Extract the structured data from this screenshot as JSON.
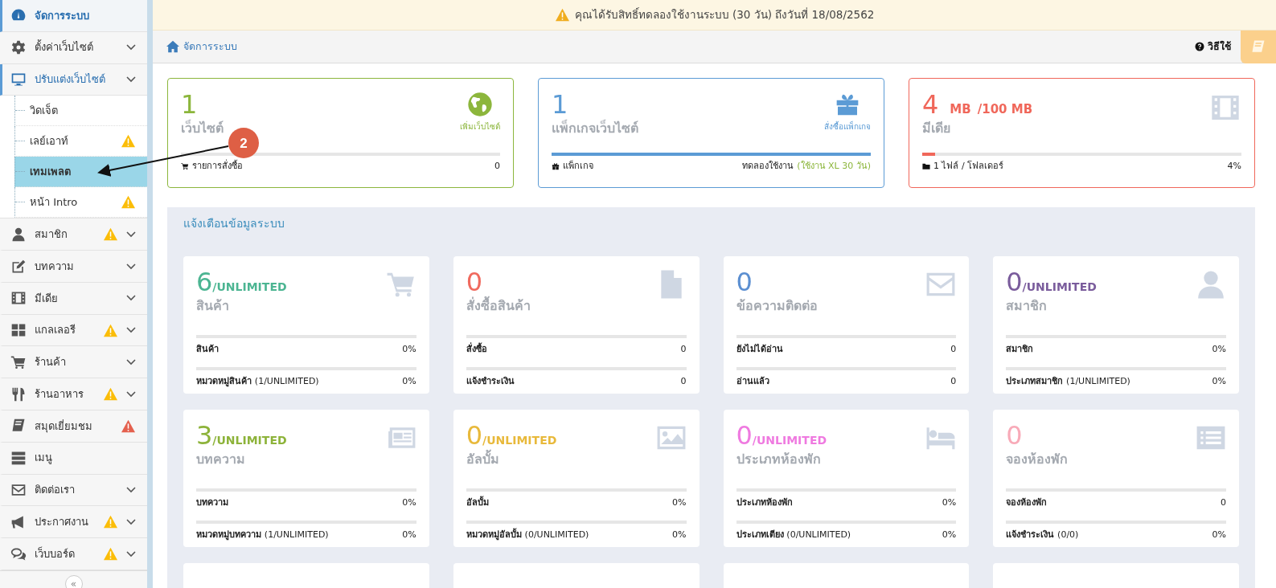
{
  "sidebar": {
    "items": [
      {
        "label": "จัดการระบบ",
        "kind": "link",
        "selected": true
      },
      {
        "label": "ตั้งค่าเว็บไซต์",
        "kind": "menu",
        "selected": false,
        "expanded": false
      },
      {
        "label": "ปรับแต่งเว็บไซต์",
        "kind": "menu",
        "selected": false,
        "expanded": true,
        "children": [
          {
            "label": "วิดเจ็ต",
            "selected": false
          },
          {
            "label": "เลย์เอาท์",
            "selected": false,
            "warning": {
              "color": "#fbbd08"
            }
          },
          {
            "label": "เทมเพลต",
            "selected": true
          },
          {
            "label": "หน้า Intro",
            "selected": false,
            "warning": {
              "color": "#fbbd08"
            }
          }
        ]
      },
      {
        "label": "สมาชิก",
        "kind": "menu",
        "selected": false,
        "expanded": false,
        "warning": {
          "color": "#fbbd08"
        }
      },
      {
        "label": "บทความ",
        "kind": "menu",
        "selected": false,
        "expanded": false
      },
      {
        "label": "มีเดีย",
        "kind": "menu",
        "selected": false,
        "expanded": false
      },
      {
        "label": "แกลเลอรี",
        "kind": "menu",
        "selected": false,
        "expanded": false,
        "warning": {
          "color": "#fbbd08"
        }
      },
      {
        "label": "ร้านค้า",
        "kind": "menu",
        "selected": false,
        "expanded": false
      },
      {
        "label": "ร้านอาหาร",
        "kind": "menu",
        "selected": false,
        "expanded": false,
        "warning": {
          "color": "#fbbd08"
        }
      },
      {
        "label": "สมุดเยี่ยมชม",
        "kind": "link",
        "selected": false,
        "warning": {
          "color": "#e4604e"
        }
      },
      {
        "label": "เมนู",
        "kind": "link",
        "selected": false
      },
      {
        "label": "ติดต่อเรา",
        "kind": "menu",
        "selected": false,
        "expanded": false
      },
      {
        "label": "ประกาศงาน",
        "kind": "menu",
        "selected": false,
        "expanded": false,
        "warning": {
          "color": "#fbbd08"
        }
      },
      {
        "label": "เว็บบอร์ด",
        "kind": "menu",
        "selected": false,
        "expanded": false,
        "warning": {
          "color": "#fbbd08"
        }
      }
    ],
    "collapse": "«"
  },
  "notice": "คุณได้รับสิทธิ์ทดลองใช้งานระบบ (30 วัน) ถึงวันที่ 18/08/2562",
  "breadcrumb": "จัดการระบบ",
  "help_link": "วิธีใช้",
  "summary_cards": [
    {
      "value": "1",
      "label": "เว็บไซต์",
      "action": "เพิ่มเว็บไซต์",
      "color": "#8cb63c",
      "level": 0,
      "footer_label": "รายการสั่งซื้อ",
      "footer_value": "0"
    },
    {
      "value": "1",
      "label": "แพ็กเกจเว็บไซต์",
      "action": "สั่งซื้อแพ็กเกจ",
      "color": "#5b9bd5",
      "level": 1,
      "footer_label": "แพ็กเกจ",
      "footer_value": "ทดลองใช้งาน",
      "footer_note": "(ใช้งาน XL 30 วัน)"
    },
    {
      "value": "4",
      "unit": "MB",
      "limit": "/100 MB",
      "label": "มีเดีย",
      "color": "#f0675a",
      "level": 0.04,
      "footer_label": "1 ไฟล์ / โฟลเดอร์",
      "footer_value": "4%"
    }
  ],
  "panel": {
    "title": "แจ้งเตือนข้อมูลระบบ",
    "cards": [
      {
        "value": "6",
        "suffix": "/UNLIMITED",
        "label": "สินค้า",
        "color": "#4cb592",
        "rows": [
          {
            "label": "สินค้า",
            "value": "0%",
            "level": 0
          },
          {
            "label": "หมวดหมู่สินค้า",
            "note": "(1/UNLIMITED)",
            "value": "0%",
            "level": 0
          }
        ]
      },
      {
        "value": "0",
        "label": "สั่งซื้อสินค้า",
        "color": "#f06a5e",
        "rows": [
          {
            "label": "สั่งซื้อ",
            "value": "0",
            "level": 0
          },
          {
            "label": "แจ้งชำระเงิน",
            "value": "0",
            "level": 0
          }
        ]
      },
      {
        "value": "0",
        "label": "ข้อความติดต่อ",
        "color": "#5b8fd1",
        "rows": [
          {
            "label": "ยังไม่ได้อ่าน",
            "value": "0",
            "level": 0
          },
          {
            "label": "อ่านแล้ว",
            "value": "0",
            "level": 0
          }
        ]
      },
      {
        "value": "0",
        "suffix": "/UNLIMITED",
        "label": "สมาชิก",
        "color": "#7a5c9c",
        "rows": [
          {
            "label": "สมาชิก",
            "value": "0%",
            "level": 0
          },
          {
            "label": "ประเภทสมาชิก",
            "note": "(1/UNLIMITED)",
            "value": "0%",
            "level": 0
          }
        ]
      },
      {
        "value": "3",
        "suffix": "/UNLIMITED",
        "label": "บทความ",
        "color": "#8db33a",
        "rows": [
          {
            "label": "บทความ",
            "value": "0%",
            "level": 0
          },
          {
            "label": "หมวดหมู่บทความ",
            "note": "(1/UNLIMITED)",
            "value": "0%",
            "level": 0
          }
        ]
      },
      {
        "value": "0",
        "suffix": "/UNLIMITED",
        "label": "อัลบั้ม",
        "color": "#e8b93b",
        "rows": [
          {
            "label": "อัลบั้ม",
            "value": "0%",
            "level": 0
          },
          {
            "label": "หมวดหมู่อัลบั้ม",
            "note": "(0/UNLIMITED)",
            "value": "0%",
            "level": 0
          }
        ]
      },
      {
        "value": "0",
        "suffix": "/UNLIMITED",
        "label": "ประเภทห้องพัก",
        "color": "#ef7ae0",
        "rows": [
          {
            "label": "ประเภทห้องพัก",
            "value": "0%",
            "level": 0
          },
          {
            "label": "ประเภทเตียง",
            "note": "(0/UNLIMITED)",
            "value": "0%",
            "level": 0
          }
        ]
      },
      {
        "value": "0",
        "label": "จองห้องพัก",
        "color": "#f8aab8",
        "rows": [
          {
            "label": "จองห้องพัก",
            "value": "0",
            "level": 0
          },
          {
            "label": "แจ้งชำระเงิน",
            "note": "(0/0)",
            "value": "0%",
            "level": 0
          }
        ]
      }
    ]
  },
  "annotation": {
    "number": "2"
  }
}
